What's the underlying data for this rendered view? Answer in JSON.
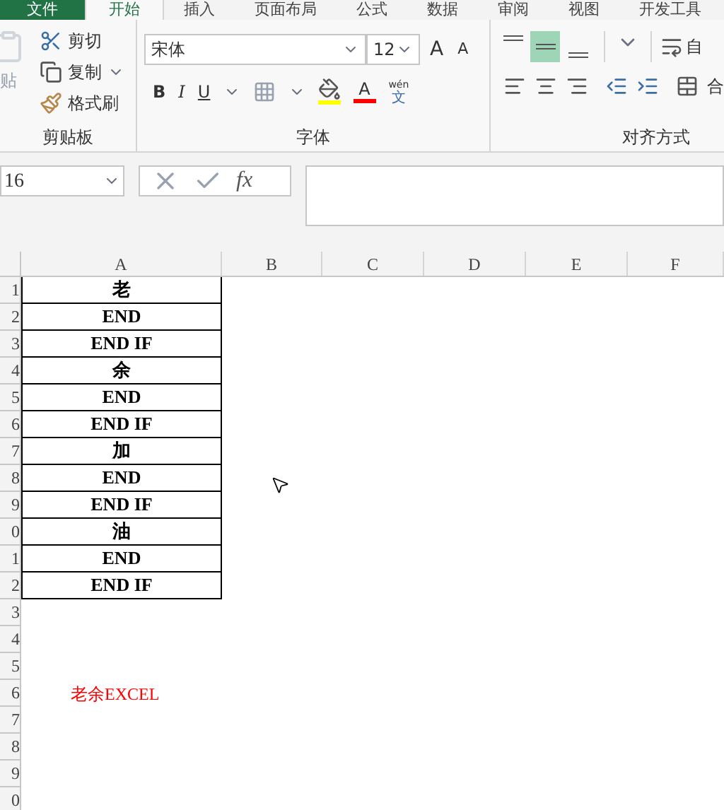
{
  "ribbon_tabs": [
    {
      "label": "文件",
      "kind": "file",
      "selected": false
    },
    {
      "label": "开始",
      "kind": "tab",
      "selected": true
    },
    {
      "label": "插入",
      "kind": "tab",
      "selected": false
    },
    {
      "label": "页面布局",
      "kind": "tab",
      "selected": false
    },
    {
      "label": "公式",
      "kind": "tab",
      "selected": false
    },
    {
      "label": "数据",
      "kind": "tab",
      "selected": false
    },
    {
      "label": "审阅",
      "kind": "tab",
      "selected": false
    },
    {
      "label": "视图",
      "kind": "tab",
      "selected": false
    },
    {
      "label": "开发工具",
      "kind": "tab",
      "selected": false
    }
  ],
  "clipboard": {
    "paste": "贴",
    "cut": "剪切",
    "copy": "复制",
    "format_painter": "格式刷",
    "label": "剪贴板"
  },
  "font": {
    "name": "宋体",
    "size": "12",
    "grow": "A",
    "shrink": "A",
    "bold": "B",
    "italic": "I",
    "underline": "U",
    "font_color": "A",
    "phonetic_top": "wén",
    "phonetic_bottom": "文",
    "label": "字体"
  },
  "alignment": {
    "vertical": [
      {
        "selected": false
      },
      {
        "selected": true
      },
      {
        "selected": false
      }
    ],
    "wrap_text": "自",
    "merge": "合",
    "label": "对齐方式"
  },
  "name_box": {
    "value": "16"
  },
  "formula_bar": {
    "fx": "fx"
  },
  "columns": [
    "A",
    "B",
    "C",
    "D",
    "E",
    "F"
  ],
  "rows": [
    {
      "header": "1",
      "kind": "table",
      "text": "老"
    },
    {
      "header": "2",
      "kind": "table",
      "text": "END"
    },
    {
      "header": "3",
      "kind": "table",
      "text": "END IF"
    },
    {
      "header": "4",
      "kind": "table",
      "text": "余"
    },
    {
      "header": "5",
      "kind": "table",
      "text": "END"
    },
    {
      "header": "6",
      "kind": "table",
      "text": "END IF"
    },
    {
      "header": "7",
      "kind": "table",
      "text": "加"
    },
    {
      "header": "8",
      "kind": "table",
      "text": "END"
    },
    {
      "header": "9",
      "kind": "table",
      "text": "END IF"
    },
    {
      "header": "0",
      "kind": "table",
      "text": "油"
    },
    {
      "header": "1",
      "kind": "table",
      "text": "END"
    },
    {
      "header": "2",
      "kind": "table",
      "text": "END IF"
    },
    {
      "header": "3",
      "kind": "empty"
    },
    {
      "header": "4",
      "kind": "empty"
    },
    {
      "header": "5",
      "kind": "empty"
    },
    {
      "header": "6",
      "kind": "note",
      "text": "老余EXCEL"
    },
    {
      "header": "7",
      "kind": "empty"
    },
    {
      "header": "8",
      "kind": "empty"
    },
    {
      "header": "9",
      "kind": "empty"
    },
    {
      "header": "0",
      "kind": "empty"
    }
  ]
}
